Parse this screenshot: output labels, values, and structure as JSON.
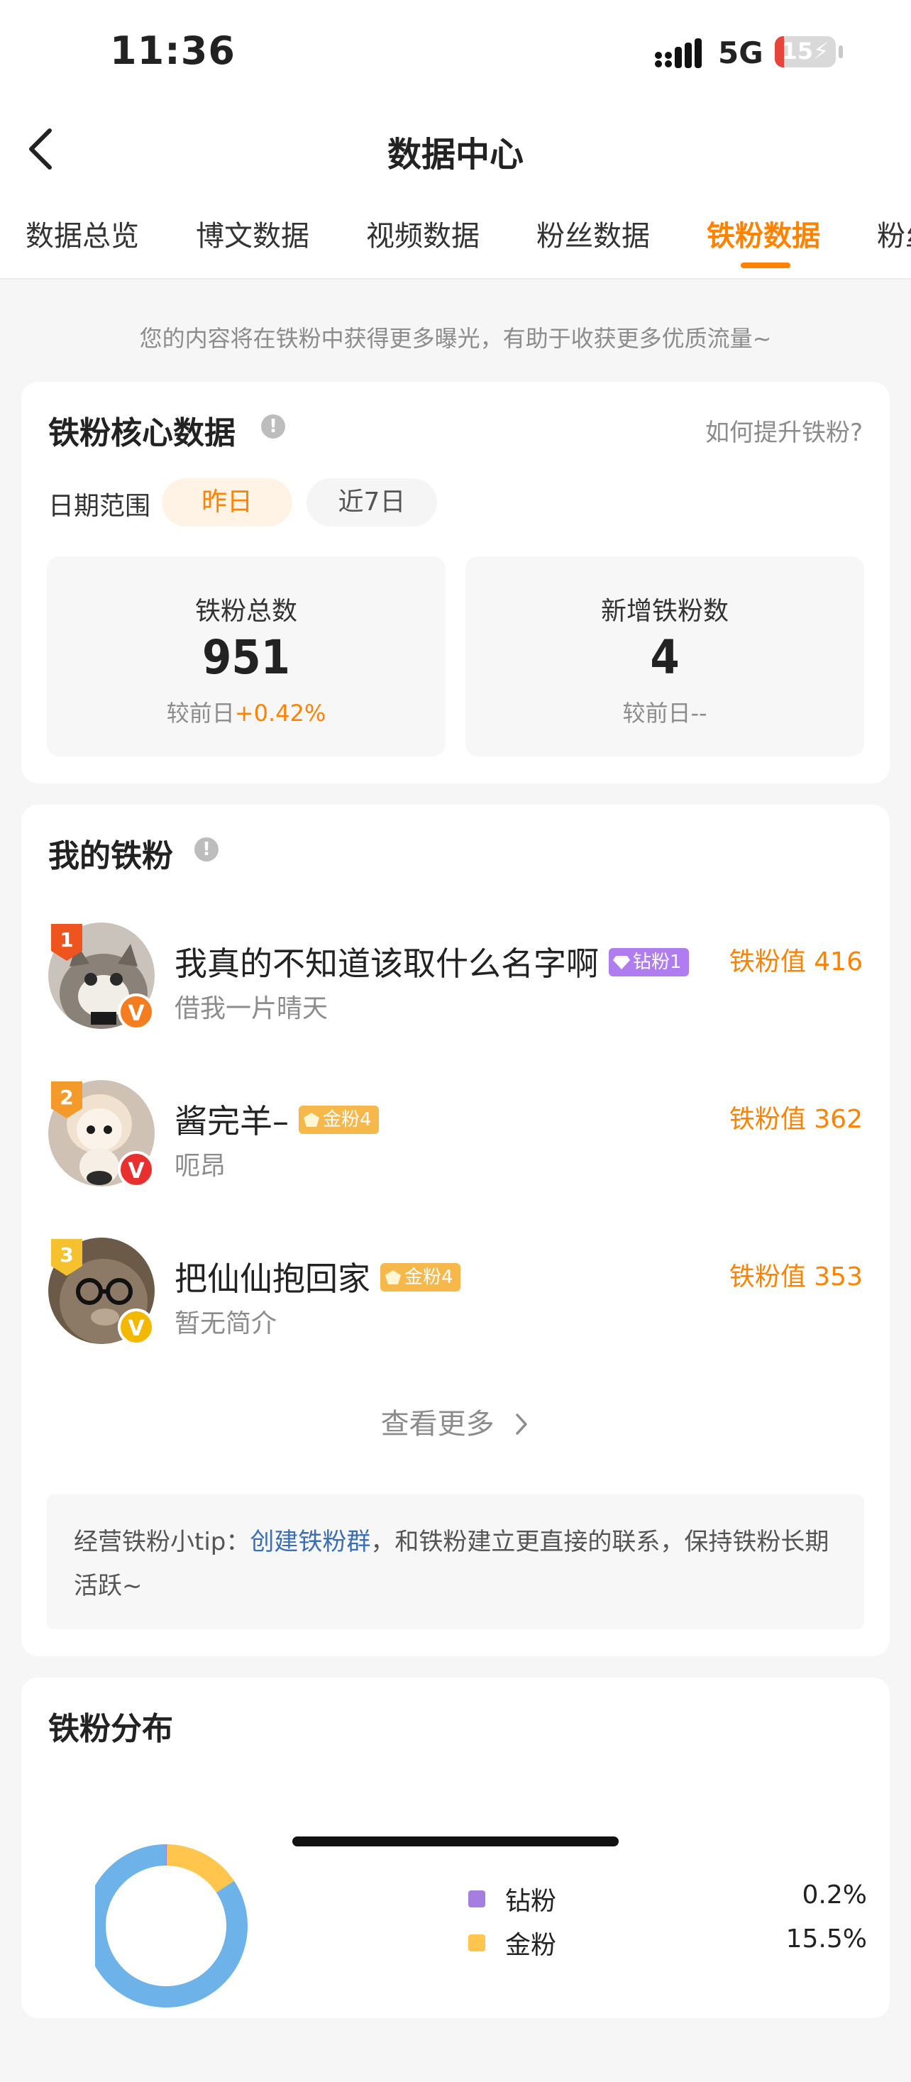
{
  "status_bar": {
    "time": "11:36",
    "network": "5G",
    "battery_level": "15",
    "battery_fraction": 0.15
  },
  "nav": {
    "title": "数据中心"
  },
  "tabs": [
    {
      "label": "数据总览"
    },
    {
      "label": "博文数据"
    },
    {
      "label": "视频数据"
    },
    {
      "label": "粉丝数据"
    },
    {
      "label": "铁粉数据"
    },
    {
      "label": "粉丝"
    }
  ],
  "active_tab": "铁粉数据",
  "notice": "您的内容将在铁粉中获得更多曝光，有助于收获更多优质流量~",
  "core": {
    "title": "铁粉核心数据",
    "how_link": "如何提升铁粉?",
    "date_range_label": "日期范围",
    "range_options": [
      "昨日",
      "近7日"
    ],
    "selected_range": "昨日",
    "total": {
      "label": "铁粉总数",
      "value": "951",
      "compare_prefix": "较前日",
      "compare_value": "+0.42%"
    },
    "new": {
      "label": "新增铁粉数",
      "value": "4",
      "compare_prefix": "较前日",
      "compare_value": "--"
    }
  },
  "my_fans": {
    "title": "我的铁粉",
    "items": [
      {
        "rank": "1",
        "name": "我真的不知道该取什么名字啊",
        "tag": "钻粉1",
        "tag_type": "diamond",
        "subtitle": "借我一片晴天",
        "score": "铁粉值 416",
        "verify_color": "#f57c1f"
      },
      {
        "rank": "2",
        "name": "酱完羊–",
        "tag": "金粉4",
        "tag_type": "gold",
        "subtitle": "呃昂",
        "score": "铁粉值 362",
        "verify_color": "#e8302f"
      },
      {
        "rank": "3",
        "name": "把仙仙抱回家",
        "tag": "金粉4",
        "tag_type": "gold",
        "subtitle": "暂无简介",
        "score": "铁粉值 353",
        "verify_color": "#f5b800"
      }
    ],
    "more_label": "查看更多",
    "tip_prefix": "经营铁粉小tip：",
    "tip_link": "创建铁粉群",
    "tip_suffix": "，和铁粉建立更直接的联系，保持铁粉长期活跃~"
  },
  "distribution": {
    "title": "铁粉分布",
    "legend": [
      {
        "name": "钻粉",
        "value": "0.2%",
        "color": "#a57ee0"
      },
      {
        "name": "金粉",
        "value": "15.5%",
        "color": "#ffc54d"
      }
    ]
  },
  "chart_data": {
    "type": "pie",
    "title": "铁粉分布",
    "labels": [
      "钻粉",
      "金粉"
    ],
    "values": [
      0.2,
      15.5
    ],
    "colors": [
      "#a57ee0",
      "#ffc54d",
      "#6db3ea"
    ]
  }
}
